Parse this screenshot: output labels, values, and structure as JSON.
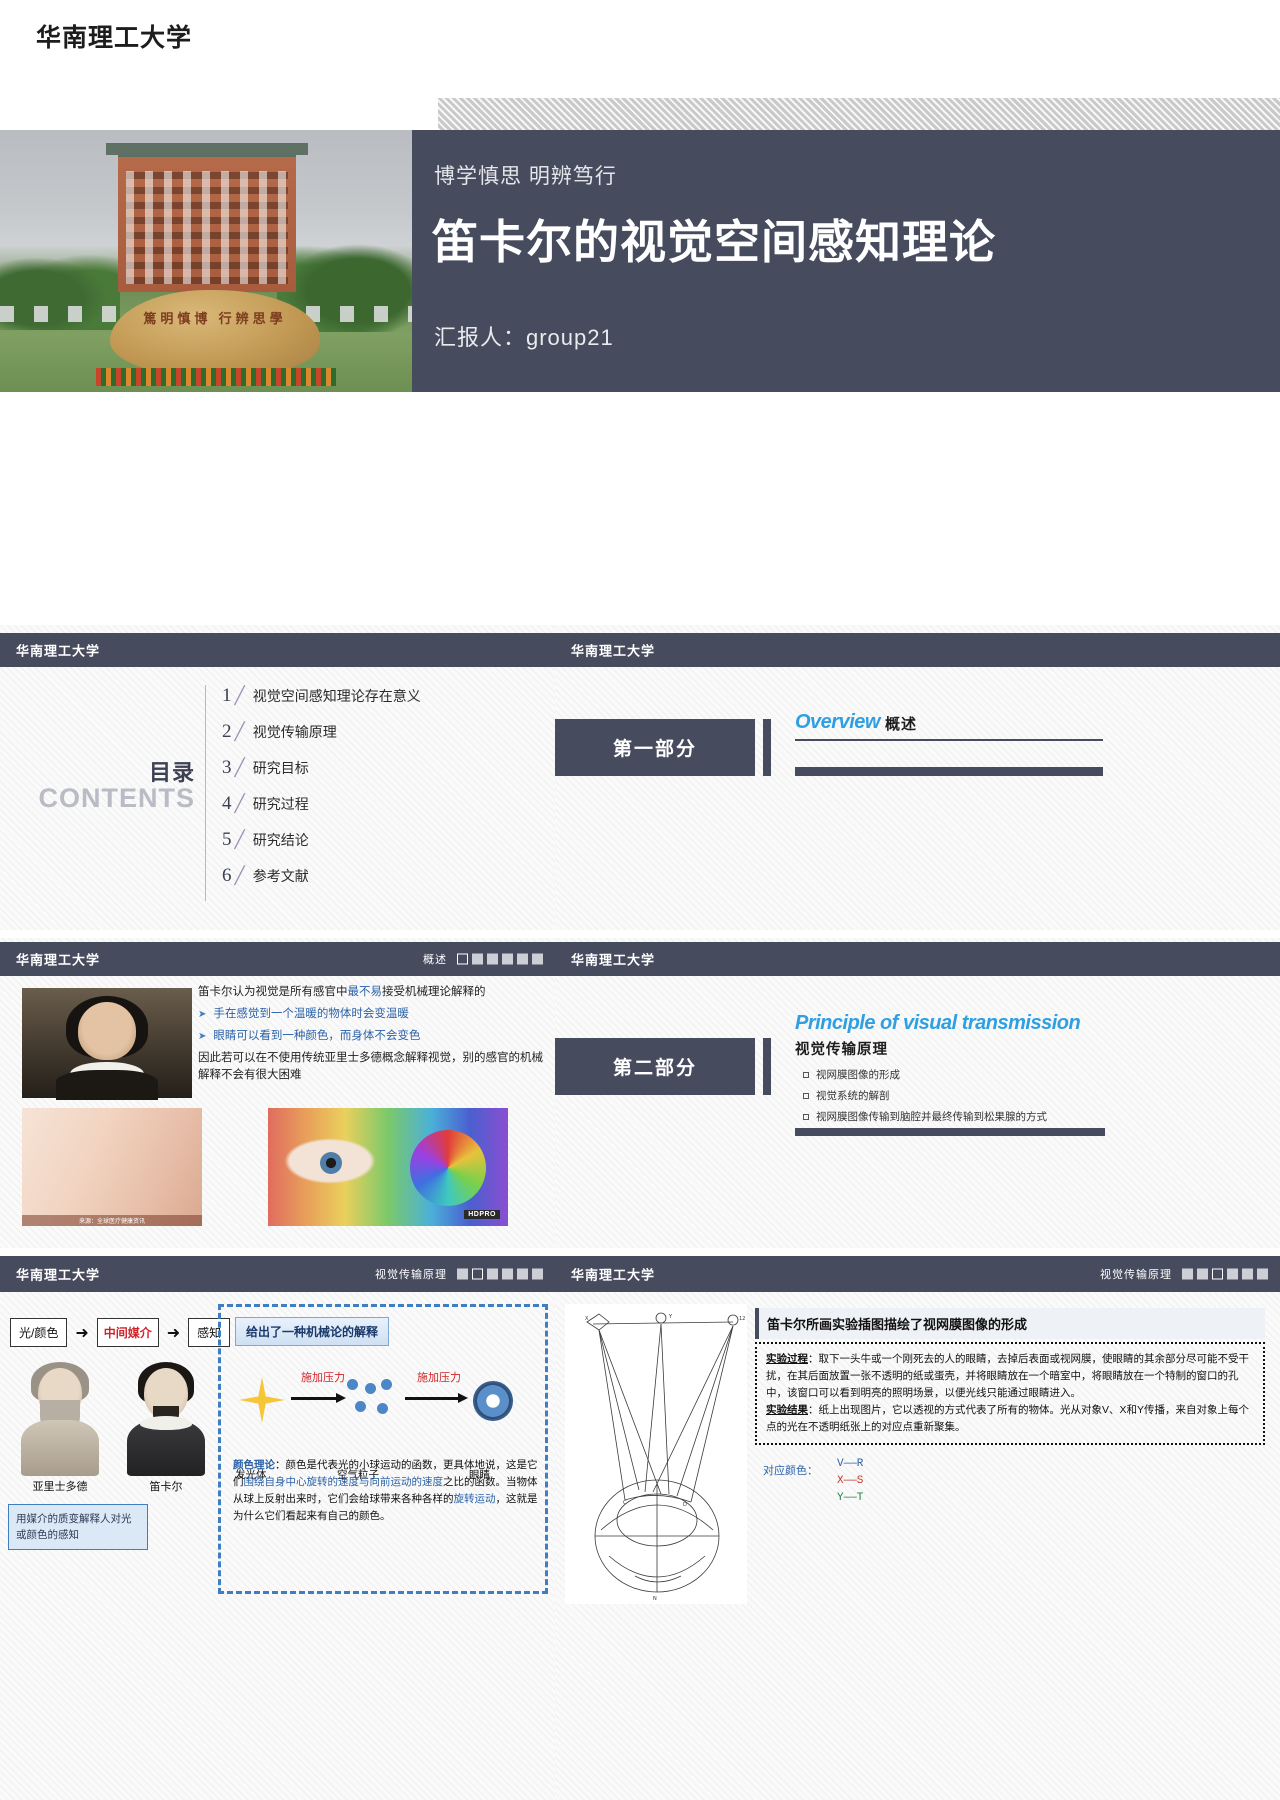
{
  "slide1": {
    "logo": "华南理工大学",
    "subtitle": "博学慎思 明辨笃行",
    "title": "笛卡尔的视觉空间感知理论",
    "presenter": "汇报人：group21",
    "photo_rock_text": "篤明慎博 行辨思學"
  },
  "slide2": {
    "logo": "华南理工大学",
    "heading_cn": "目录",
    "heading_en": "CONTENTS",
    "items": [
      {
        "num": "1",
        "label": "视觉空间感知理论存在意义"
      },
      {
        "num": "2",
        "label": "视觉传输原理"
      },
      {
        "num": "3",
        "label": "研究目标"
      },
      {
        "num": "4",
        "label": "研究过程"
      },
      {
        "num": "5",
        "label": "研究结论"
      },
      {
        "num": "6",
        "label": "参考文献"
      }
    ]
  },
  "slide3": {
    "logo": "华南理工大学",
    "part_label": "第一部分",
    "title_en": "Overview",
    "title_cn": "概述"
  },
  "slide4": {
    "logo": "华南理工大学",
    "section": "概述",
    "pager": [
      "hollow",
      "solid",
      "solid",
      "solid",
      "solid",
      "solid"
    ],
    "lead_a": "笛卡尔认为视觉是所有感官中",
    "lead_hl": "最不易",
    "lead_b": "接受机械理论解释的",
    "bullets": [
      "手在感觉到一个温暖的物体时会变温暖",
      "眼睛可以看到一种颜色，而身体不会变色"
    ],
    "tail": "因此若可以在不使用传统亚里士多德概念解释视觉，别的感官的机械解释不会有很大困难",
    "img_caption": "来源：全球医疗健康资讯",
    "img_badge": "HDPRO"
  },
  "slide5": {
    "logo": "华南理工大学",
    "part_label": "第二部分",
    "title_en": "Principle of visual transmission",
    "title_cn": "视觉传输原理",
    "items": [
      "视网膜图像的形成",
      "视觉系统的解剖",
      "视网膜图像传输到脑腔并最终传输到松果腺的方式"
    ]
  },
  "slide6": {
    "logo": "华南理工大学",
    "section": "视觉传输原理",
    "pager": [
      "solid",
      "hollow",
      "solid",
      "solid",
      "solid",
      "solid"
    ],
    "flow": {
      "left": "光/颜色",
      "middle": "中间媒介",
      "right": "感知",
      "arrow": "➜"
    },
    "figures": [
      {
        "name": "亚里士多德"
      },
      {
        "name": "笛卡尔"
      }
    ],
    "note": "用媒介的质变解释人对光或颜色的感知",
    "mech_title": "给出了一种机械论的解释",
    "mech_arrow_label_1": "施加压力",
    "mech_arrow_label_2": "施加压力",
    "mech_captions": [
      "发光体",
      "空气粒子",
      "眼睛"
    ],
    "color_theory_label": "颜色理论",
    "color_theory_a": "：颜色是代表光的小球运动的函数，更具体地说，",
    "color_theory_b": "这是它们",
    "color_theory_hl1": "围绕自身中心旋转的速度与向前运动的速度",
    "color_theory_c": "之比的",
    "color_theory_d": "函数。当物体从球上反射出来时，它们会给球带来各种各样",
    "color_theory_e": "的",
    "color_theory_hl2": "旋转运动",
    "color_theory_f": "，这就是为什么它们看起来有自己的颜色。"
  },
  "slide7": {
    "logo": "华南理工大学",
    "section": "视觉传输原理",
    "pager": [
      "solid",
      "solid",
      "hollow",
      "solid",
      "solid",
      "solid"
    ],
    "header": "笛卡尔所画实验插图描绘了视网膜图像的形成",
    "exp_label_1": "实验过程",
    "exp_text_1": "：取下一头牛或一个刚死去的人的眼睛，去掉后表面或视网膜，使眼睛的其余部分尽可能不受干扰，在其后面放置一张不透明的纸或蛋壳，并将眼睛放在一个暗室中，将眼睛放在一个特制的窗口的孔中，该窗口可以看到明亮的照明场景，以便光线只能通过眼睛进入。",
    "exp_label_2": "实验结果",
    "exp_text_2": "：纸上出现图片，它以透视的方式代表了所有的物体。光从对象V、X和Y传播，来自对象上每个点的光在不透明纸张上的对应点重新聚集。",
    "map_label": "对应颜色：",
    "map_items": [
      "V——R",
      "X——S",
      "Y——T"
    ]
  },
  "theme": {
    "dark": "#464b5e",
    "accent_blue": "#2e9fe0",
    "link_blue": "#2b62a8",
    "red": "#d2232a"
  }
}
